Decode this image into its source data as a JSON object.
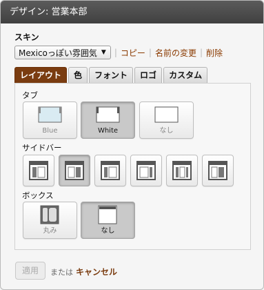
{
  "title": "デザイン: 営業本部",
  "skin": {
    "label": "スキン",
    "selected": "Mexicoっぽい雰囲気",
    "actions": [
      "コピー",
      "名前の変更",
      "削除"
    ]
  },
  "tabs": [
    "レイアウト",
    "色",
    "フォント",
    "ロゴ",
    "カスタム"
  ],
  "groups": {
    "tab": {
      "label": "タブ",
      "options": [
        {
          "caption": "Blue",
          "selected": false,
          "icon": "tab-blue-icon"
        },
        {
          "caption": "White",
          "selected": true,
          "icon": "tab-white-icon"
        },
        {
          "caption": "なし",
          "selected": false,
          "icon": "tab-none-icon"
        }
      ]
    },
    "sidebar": {
      "label": "サイドバー",
      "options": [
        {
          "selected": false,
          "icon": "sidebar-layout-1-icon"
        },
        {
          "selected": true,
          "icon": "sidebar-layout-2-icon"
        },
        {
          "selected": false,
          "icon": "sidebar-layout-3-icon"
        },
        {
          "selected": false,
          "icon": "sidebar-layout-4-icon"
        },
        {
          "selected": false,
          "icon": "sidebar-layout-5-icon"
        },
        {
          "selected": false,
          "icon": "sidebar-layout-6-icon"
        }
      ]
    },
    "box": {
      "label": "ボックス",
      "options": [
        {
          "caption": "丸み",
          "selected": false,
          "icon": "box-rounded-icon"
        },
        {
          "caption": "なし",
          "selected": true,
          "icon": "box-none-icon"
        }
      ]
    }
  },
  "footer": {
    "apply": "適用",
    "or_text": "または",
    "cancel": "キャンセル"
  },
  "colors": {
    "accent": "#7a3c10",
    "link": "#8a3a00",
    "titlebar": "#4a4a4a"
  }
}
